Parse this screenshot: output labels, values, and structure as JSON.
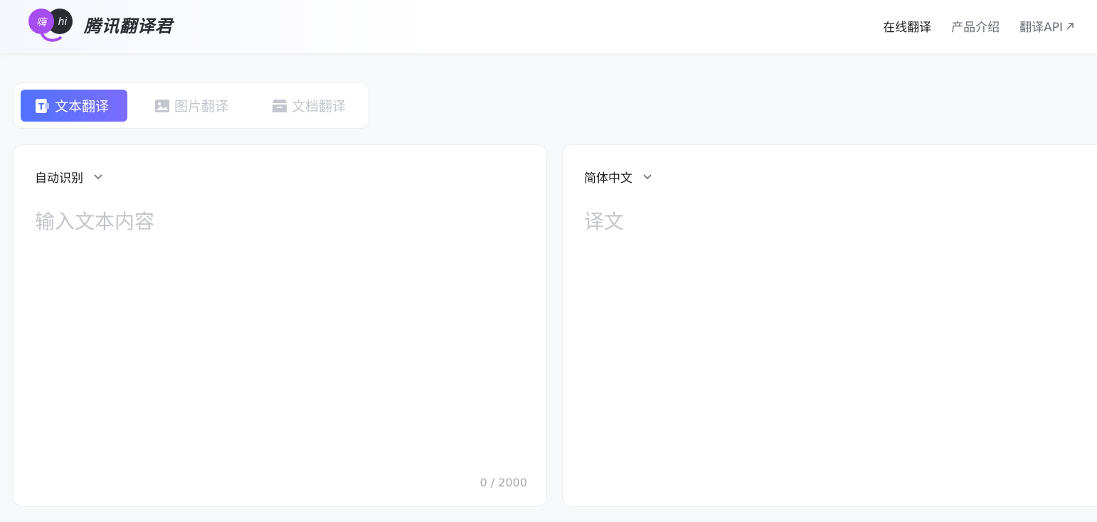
{
  "header": {
    "logo_text_a": "嗨",
    "logo_text_b": "hi",
    "brand": "腾讯翻译君",
    "nav": [
      {
        "label": "在线翻译",
        "active": true
      },
      {
        "label": "产品介绍",
        "active": false
      },
      {
        "label": "翻译API",
        "active": false,
        "external": true
      }
    ]
  },
  "tabs": [
    {
      "label": "文本翻译",
      "icon": "text-translate-icon",
      "active": true
    },
    {
      "label": "图片翻译",
      "icon": "image-icon",
      "active": false
    },
    {
      "label": "文档翻译",
      "icon": "document-icon",
      "active": false
    }
  ],
  "source": {
    "language": "自动识别",
    "placeholder": "输入文本内容",
    "counter": "0 / 2000"
  },
  "target": {
    "language": "简体中文",
    "placeholder": "译文"
  },
  "colors": {
    "accent_start": "#4f73ff",
    "accent_end": "#7b6cff",
    "logo_purple": "#a64df0",
    "logo_dark": "#2b2b33"
  }
}
